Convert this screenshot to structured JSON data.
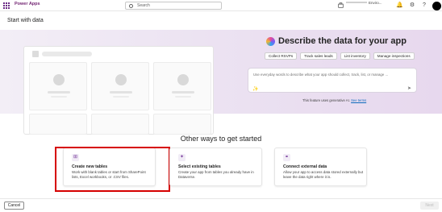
{
  "app": {
    "name": "Power Apps"
  },
  "topbar": {
    "search_placeholder": "Search",
    "environment_label": "Enviro...",
    "icons": [
      "waffle-icon",
      "search-icon",
      "environment-icon",
      "bell-icon",
      "gear-icon",
      "help-icon",
      "avatar"
    ]
  },
  "page": {
    "title": "Start with data"
  },
  "hero": {
    "heading": "Describe the data for your app",
    "chips": [
      "Collect RSVPs",
      "Track sales leads",
      "List inventory",
      "Manage inspections"
    ],
    "prompt_placeholder": "Use everyday words to describe what your app should collect, track, list, or manage ...",
    "disclaimer": "This feature uses generative AI.",
    "disclaimer_link": "See terms"
  },
  "other": {
    "heading": "Other ways to get started",
    "cards": [
      {
        "title": "Create new tables",
        "description": "Work with blank tables or start from SharePoint lists, Excel workbooks, or .CSV files."
      },
      {
        "title": "Select existing tables",
        "description": "Create your app from tables you already have in Dataverse."
      },
      {
        "title": "Connect external data",
        "description": "Allow your app to access data stored externally but leave the data right where it is."
      }
    ]
  },
  "footer": {
    "cancel_label": "Cancel",
    "next_label": "Next"
  },
  "colors": {
    "brand": "#742774",
    "highlight": "#d60000",
    "link": "#0f6cbd"
  }
}
